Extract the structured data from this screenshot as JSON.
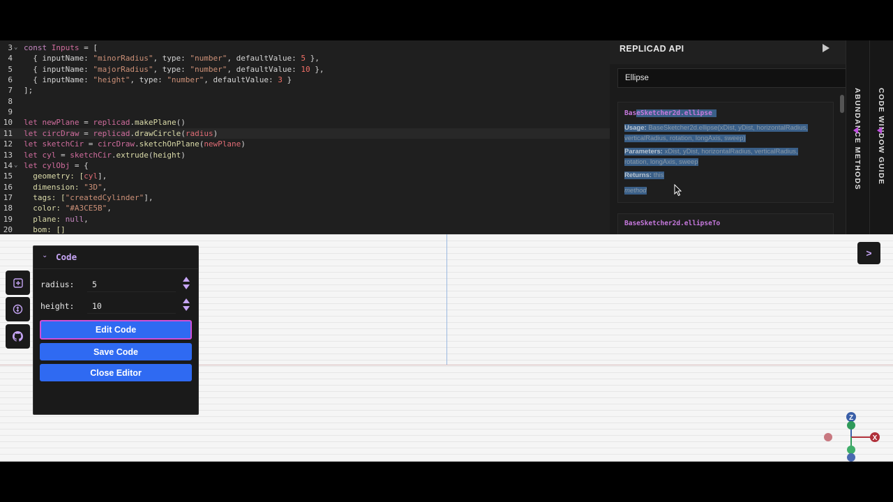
{
  "editor": {
    "lines": [
      {
        "n": "3",
        "fold": "⌄",
        "tokens": [
          {
            "t": "const ",
            "c": "kw"
          },
          {
            "t": "Inputs",
            "c": "id"
          },
          {
            "t": " = [",
            "c": ""
          }
        ]
      },
      {
        "n": "4",
        "fold": "",
        "tokens": [
          {
            "t": "  { inputName: ",
            "c": ""
          },
          {
            "t": "\"minorRadius\"",
            "c": "str"
          },
          {
            "t": ", type: ",
            "c": ""
          },
          {
            "t": "\"number\"",
            "c": "str"
          },
          {
            "t": ", defaultValue: ",
            "c": ""
          },
          {
            "t": "5",
            "c": "num"
          },
          {
            "t": " },",
            "c": ""
          }
        ]
      },
      {
        "n": "5",
        "fold": "",
        "tokens": [
          {
            "t": "  { inputName: ",
            "c": ""
          },
          {
            "t": "\"majorRadius\"",
            "c": "str"
          },
          {
            "t": ", type: ",
            "c": ""
          },
          {
            "t": "\"number\"",
            "c": "str"
          },
          {
            "t": ", defaultValue: ",
            "c": ""
          },
          {
            "t": "10",
            "c": "num"
          },
          {
            "t": " },",
            "c": ""
          }
        ]
      },
      {
        "n": "6",
        "fold": "",
        "tokens": [
          {
            "t": "  { inputName: ",
            "c": ""
          },
          {
            "t": "\"height\"",
            "c": "str"
          },
          {
            "t": ", type: ",
            "c": ""
          },
          {
            "t": "\"number\"",
            "c": "str"
          },
          {
            "t": ", defaultValue: ",
            "c": ""
          },
          {
            "t": "3",
            "c": "num"
          },
          {
            "t": " }",
            "c": ""
          }
        ]
      },
      {
        "n": "7",
        "fold": "",
        "tokens": [
          {
            "t": "];",
            "c": ""
          }
        ]
      },
      {
        "n": "8",
        "fold": "",
        "tokens": []
      },
      {
        "n": "9",
        "fold": "",
        "tokens": []
      },
      {
        "n": "10",
        "fold": "",
        "tokens": [
          {
            "t": "let ",
            "c": "kw2"
          },
          {
            "t": "newPlane",
            "c": "id"
          },
          {
            "t": " = ",
            "c": ""
          },
          {
            "t": "replicad",
            "c": "id"
          },
          {
            "t": ".",
            "c": ""
          },
          {
            "t": "makePlane",
            "c": "fn"
          },
          {
            "t": "()",
            "c": ""
          }
        ]
      },
      {
        "n": "11",
        "fold": "",
        "active": true,
        "tokens": [
          {
            "t": "let ",
            "c": "kw2"
          },
          {
            "t": "circDraw",
            "c": "id"
          },
          {
            "t": " = ",
            "c": ""
          },
          {
            "t": "replicad",
            "c": "id"
          },
          {
            "t": ".",
            "c": ""
          },
          {
            "t": "drawCircle",
            "c": "fn"
          },
          {
            "t": "(",
            "c": ""
          },
          {
            "t": "radius",
            "c": "var"
          },
          {
            "t": ")",
            "c": ""
          }
        ]
      },
      {
        "n": "12",
        "fold": "",
        "tokens": [
          {
            "t": "let ",
            "c": "kw2"
          },
          {
            "t": "sketchCir",
            "c": "id"
          },
          {
            "t": " = ",
            "c": ""
          },
          {
            "t": "circDraw",
            "c": "id"
          },
          {
            "t": ".",
            "c": ""
          },
          {
            "t": "sketchOnPlane",
            "c": "fn"
          },
          {
            "t": "(",
            "c": ""
          },
          {
            "t": "newPlane",
            "c": "var"
          },
          {
            "t": ")",
            "c": ""
          }
        ]
      },
      {
        "n": "13",
        "fold": "",
        "tokens": [
          {
            "t": "let ",
            "c": "kw2"
          },
          {
            "t": "cyl",
            "c": "id"
          },
          {
            "t": " = ",
            "c": ""
          },
          {
            "t": "sketchCir",
            "c": "id"
          },
          {
            "t": ".",
            "c": ""
          },
          {
            "t": "extrude",
            "c": "fn"
          },
          {
            "t": "(",
            "c": ""
          },
          {
            "t": "height",
            "c": "fn"
          },
          {
            "t": ")",
            "c": ""
          }
        ]
      },
      {
        "n": "14",
        "fold": "⌄",
        "tokens": [
          {
            "t": "let ",
            "c": "kw2"
          },
          {
            "t": "cylObj",
            "c": "id"
          },
          {
            "t": " = {",
            "c": ""
          }
        ]
      },
      {
        "n": "15",
        "fold": "",
        "tokens": [
          {
            "t": "  geometry: [",
            "c": "fn"
          },
          {
            "t": "cyl",
            "c": "var"
          },
          {
            "t": "],",
            "c": ""
          }
        ]
      },
      {
        "n": "16",
        "fold": "",
        "tokens": [
          {
            "t": "  dimension: ",
            "c": "fn"
          },
          {
            "t": "\"3D\"",
            "c": "str"
          },
          {
            "t": ",",
            "c": ""
          }
        ]
      },
      {
        "n": "17",
        "fold": "",
        "tokens": [
          {
            "t": "  tags: [",
            "c": "fn"
          },
          {
            "t": "\"createdCylinder\"",
            "c": "str"
          },
          {
            "t": "],",
            "c": ""
          }
        ]
      },
      {
        "n": "18",
        "fold": "",
        "tokens": [
          {
            "t": "  color: ",
            "c": "fn"
          },
          {
            "t": "\"#A3CE5B\"",
            "c": "str"
          },
          {
            "t": ",",
            "c": ""
          }
        ]
      },
      {
        "n": "19",
        "fold": "",
        "tokens": [
          {
            "t": "  plane: ",
            "c": "fn"
          },
          {
            "t": "null",
            "c": "kw"
          },
          {
            "t": ",",
            "c": ""
          }
        ]
      },
      {
        "n": "20",
        "fold": "",
        "tokens": [
          {
            "t": "  bom: []",
            "c": "fn"
          }
        ]
      }
    ]
  },
  "api": {
    "title": "REPLICAD API",
    "search_value": "Ellipse",
    "card1": {
      "method": "BaseSketcher2d.ellipse",
      "usage_label": "Usage:",
      "usage_line1": "BaseSketcher2d.ellipse(xDist, yDist, horizontalRadius,",
      "usage_line2": "verticalRadius, rotation, longAxis, sweep)",
      "params_label": "Parameters:",
      "params_line1": "xDist, yDist, horizontalRadius, verticalRadius,",
      "params_line2": "rotation, longAxis, sweep",
      "returns_label": "Returns:",
      "returns_value": "this",
      "tag": "method"
    },
    "card2": {
      "method": "BaseSketcher2d.ellipseTo"
    }
  },
  "tabs": {
    "abundance": "ABUNDANCE METHODS",
    "guide": "CODE WINDOW GUIDE"
  },
  "code_panel": {
    "title": "Code",
    "fields": [
      {
        "label": "radius:",
        "value": "5"
      },
      {
        "label": "height:",
        "value": "10"
      }
    ],
    "edit_label": "Edit Code",
    "save_label": "Save Code",
    "close_label": "Close Editor"
  },
  "viewport": {
    "expand_label": ">"
  },
  "gizmo": {
    "z": "Z",
    "x": "X"
  },
  "colors": {
    "accent": "#2F6AF2",
    "purple": "#C6A5F5",
    "highlight": "#3A5F88"
  },
  "icons": {
    "add": "plus-square-icon",
    "web3": "coin-icon",
    "github": "github-icon",
    "cursor": "mouse-pointer-icon"
  }
}
